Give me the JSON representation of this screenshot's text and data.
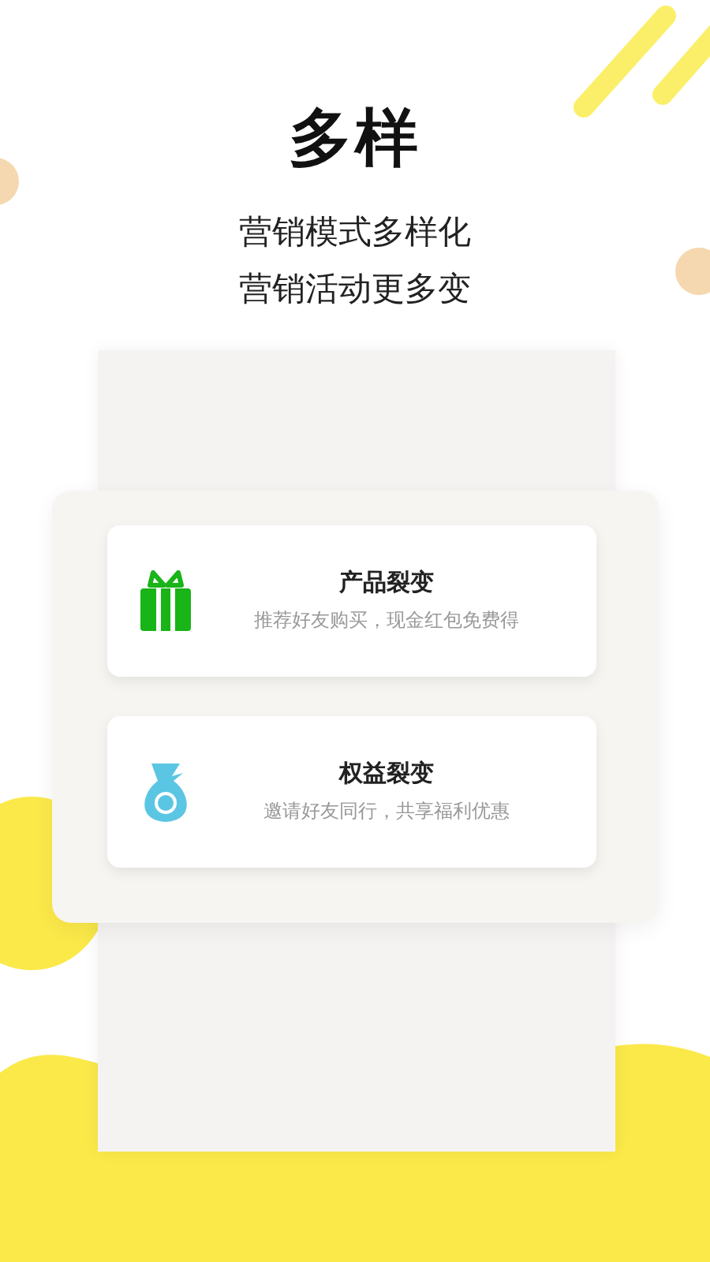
{
  "headline": "多样",
  "subtitle_lines": [
    "营销模式多样化",
    "营销活动更多变"
  ],
  "features": [
    {
      "kind": "gift",
      "title": "产品裂变",
      "description": "推荐好友购买，现金红包免费得"
    },
    {
      "kind": "moneybag",
      "title": "权益裂变",
      "description": "邀请好友同行，共享福利优惠"
    }
  ]
}
